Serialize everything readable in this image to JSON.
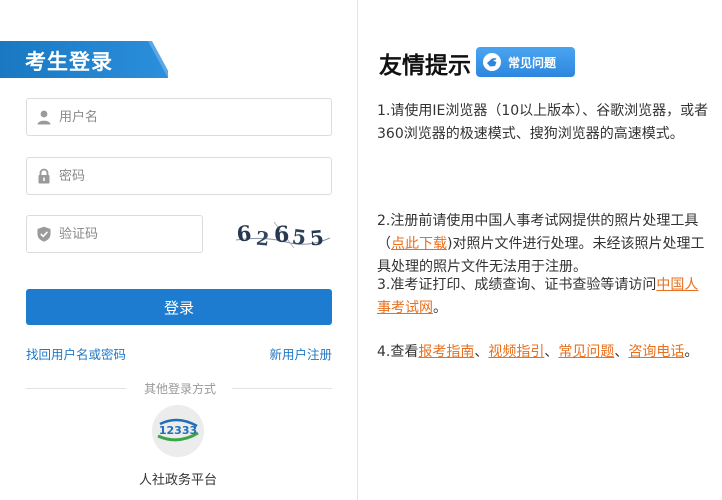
{
  "login": {
    "title": "考生登录",
    "username_placeholder": "用户名",
    "password_placeholder": "密码",
    "captcha_placeholder": "验证码",
    "captcha_text": [
      "6",
      "2",
      "6",
      "5",
      "5"
    ],
    "login_button": "登录",
    "recover_link": "找回用户名或密码",
    "register_link": "新用户注册",
    "other_methods": "其他登录方式",
    "alt_platform_label": "人社政务平台",
    "alt_platform_logo_text": "12333"
  },
  "tips": {
    "title": "友情提示",
    "faq_badge": "常见问题",
    "tip1": "1.请使用IE浏览器（10以上版本）、谷歌浏览器，或者360浏览器的极速模式、搜狗浏览器的高速模式。",
    "tip2": {
      "before": "2.注册前请使用中国人事考试网提供的照片处理工具（",
      "link": "点此下载",
      "after": ")对照片文件进行处理。未经该照片处理工具处理的照片文件无法用于注册。"
    },
    "tip3": {
      "before": "3.准考证打印、成绩查询、证书查验等请访问",
      "link": "中国人事考试网",
      "after": "。"
    },
    "tip4": {
      "before": "4.查看",
      "link1": "报考指南",
      "sep1": "、",
      "link2": "视频指引",
      "sep2": "、",
      "link3": "常见问题",
      "sep3": "、",
      "link4": "咨询电话",
      "after": "。"
    }
  },
  "colors": {
    "primary": "#1e7cd0",
    "link_blue": "#1e78c8",
    "link_orange": "#e8701f",
    "badge": "#2d86de"
  },
  "icons": {
    "username": "user-icon",
    "password": "lock-icon",
    "captcha": "shield-icon",
    "faq": "pointing-hand-icon"
  }
}
